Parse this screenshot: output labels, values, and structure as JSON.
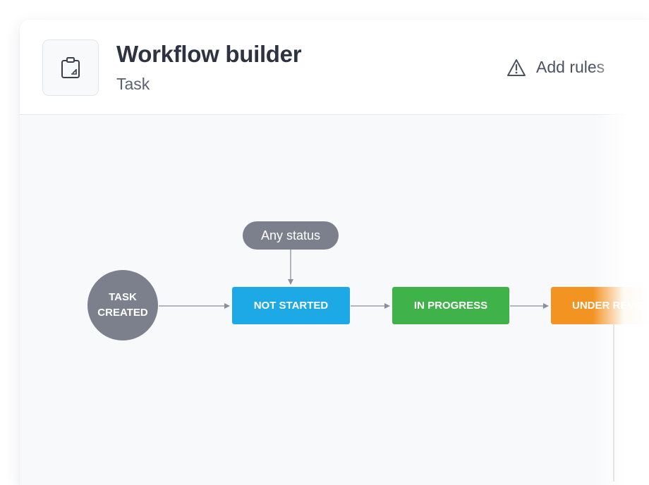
{
  "header": {
    "title": "Workflow builder",
    "subtitle": "Task",
    "icon": "clipboard-icon",
    "add_rules_icon": "warning-triangle-icon",
    "add_rules_label": "Add rules"
  },
  "workflow": {
    "start_node": "TASK\nCREATED",
    "any_status_label": "Any status",
    "statuses": [
      {
        "label": "NOT STARTED",
        "color": "#1ca9e6"
      },
      {
        "label": "IN PROGRESS",
        "color": "#3fb24a"
      },
      {
        "label": "UNDER REVIEW",
        "color": "#f29322"
      }
    ],
    "start_node_color": "#7b808c",
    "connector_color": "#8a8f99"
  }
}
